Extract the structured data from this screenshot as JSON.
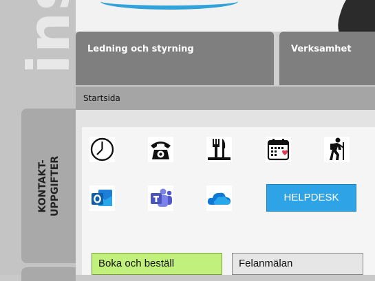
{
  "background": {
    "watermark_text": "ins"
  },
  "tabs": [
    {
      "label": "Ledning och styrning"
    },
    {
      "label": "Verksamhet"
    }
  ],
  "breadcrumb": {
    "label": "Startsida"
  },
  "side_tab": {
    "label_line1": "KONTAKT-",
    "label_line2": "UPPGIFTER"
  },
  "shortcuts": {
    "row1": [
      "clock-icon",
      "telephone-icon",
      "restaurant-icon",
      "calendar-icon",
      "hiker-icon"
    ],
    "row2": [
      "outlook-icon",
      "teams-icon",
      "onedrive-icon"
    ]
  },
  "helpdesk": {
    "label": "HELPDESK"
  },
  "buttons": {
    "boka": "Boka och beställ",
    "felanmalan": "Felanmälan"
  },
  "colors": {
    "helpdesk_bg": "#2ea3e6",
    "boka_bg": "#c2f07c",
    "tab_bg": "#7f7f7f",
    "accent": "#1e9bd7"
  }
}
